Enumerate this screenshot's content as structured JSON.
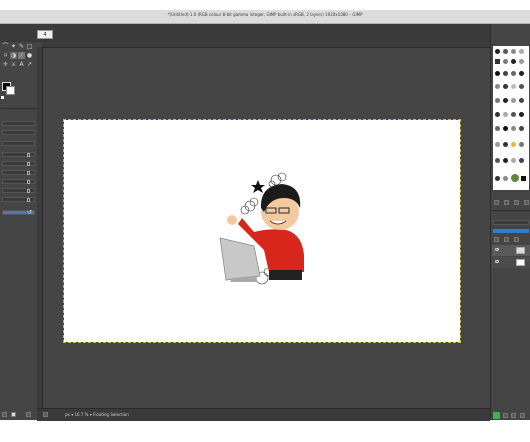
{
  "window": {
    "title": "*[Untitled]-1.0 (RGB colour 8-bit gamma integer, GIMP built-in sRGB, 2 layers) 1920x1080 – GIMP"
  },
  "image_tabs": [
    {
      "label": "4"
    }
  ],
  "status_bar": {
    "unit": "px",
    "zoom": "16.7 %",
    "message": "Floating Selection"
  },
  "colors": {
    "accent_green": "#3fb34f",
    "dock_blue": "#2f7fd0"
  }
}
